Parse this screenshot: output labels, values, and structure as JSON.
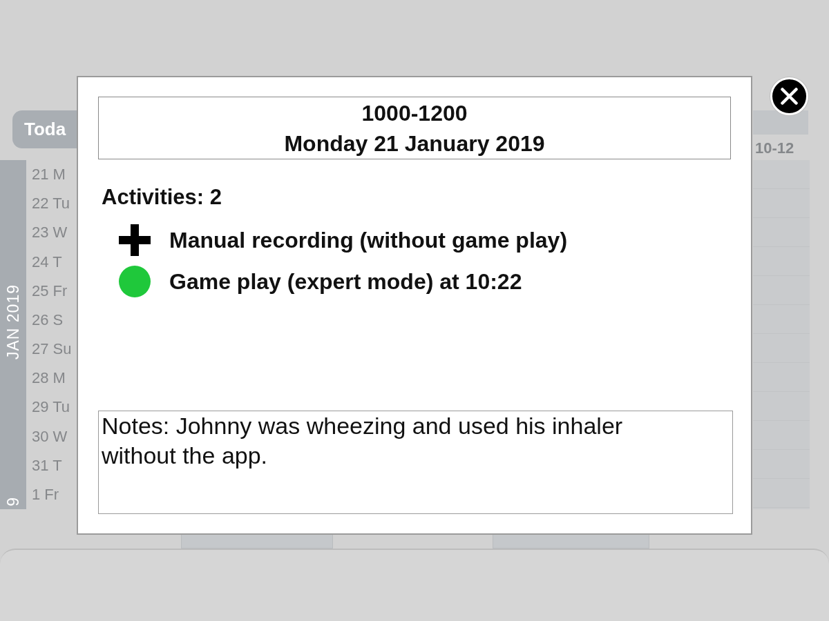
{
  "background": {
    "today_button": "Toda",
    "column_header": "10-12",
    "month_labels": [
      "JAN 2019",
      "9"
    ],
    "days": [
      "21 M",
      "22 Tu",
      "23 W",
      "24 T",
      "25 Fr",
      "26 S",
      "27 Su",
      "28 M",
      "29 Tu",
      "30 W",
      "31 T",
      "1 Fr"
    ]
  },
  "dialog": {
    "time_range": "1000-1200",
    "date": "Monday 21 January 2019",
    "activities_label": "Activities: 2",
    "activities": [
      {
        "kind": "manual",
        "label": "Manual recording (without game play)"
      },
      {
        "kind": "game",
        "label": "Game play (expert mode) at 10:22"
      }
    ],
    "notes": "Notes: Johnny was wheezing and used his inhaler without the app."
  }
}
